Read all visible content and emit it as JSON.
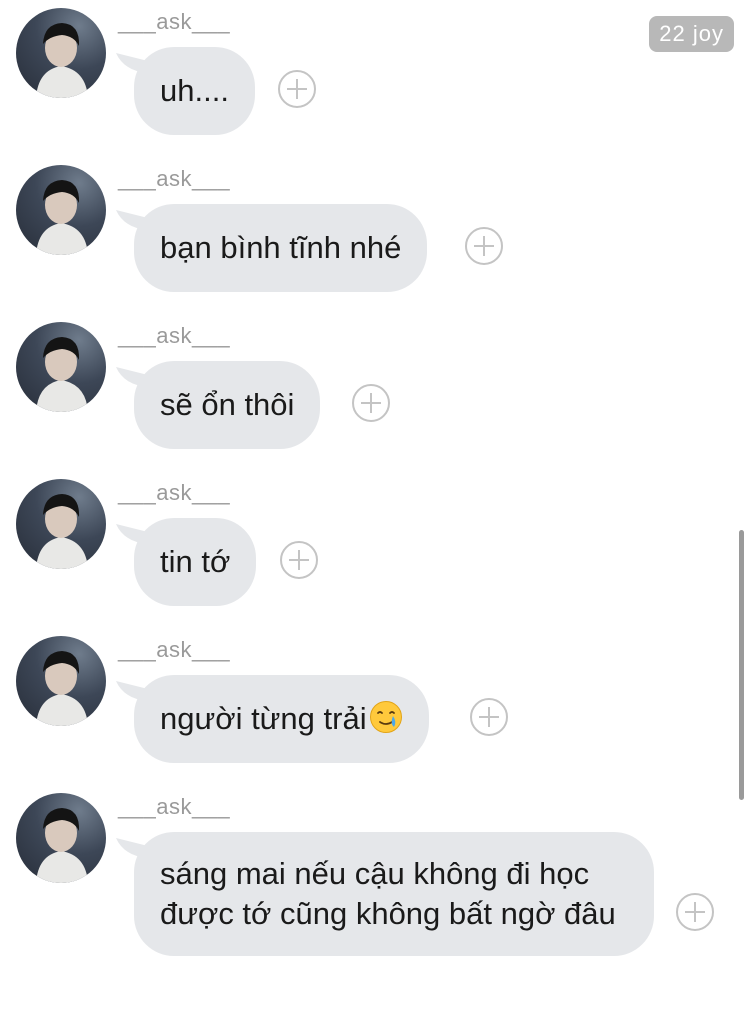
{
  "header": {
    "badge": "22 joy"
  },
  "messages": [
    {
      "sender": "___ask___",
      "text": "uh...."
    },
    {
      "sender": "___ask___",
      "text": "bạn bình tĩnh nhé"
    },
    {
      "sender": "___ask___",
      "text": "sẽ ổn thôi"
    },
    {
      "sender": "___ask___",
      "text": "tin tớ"
    },
    {
      "sender": "___ask___",
      "text": "người từng trải",
      "emoji": "crying-smile-emoji"
    },
    {
      "sender": "___ask___",
      "text": "sáng mai nếu cậu không đi học được tớ cũng không bất ngờ đâu"
    }
  ]
}
